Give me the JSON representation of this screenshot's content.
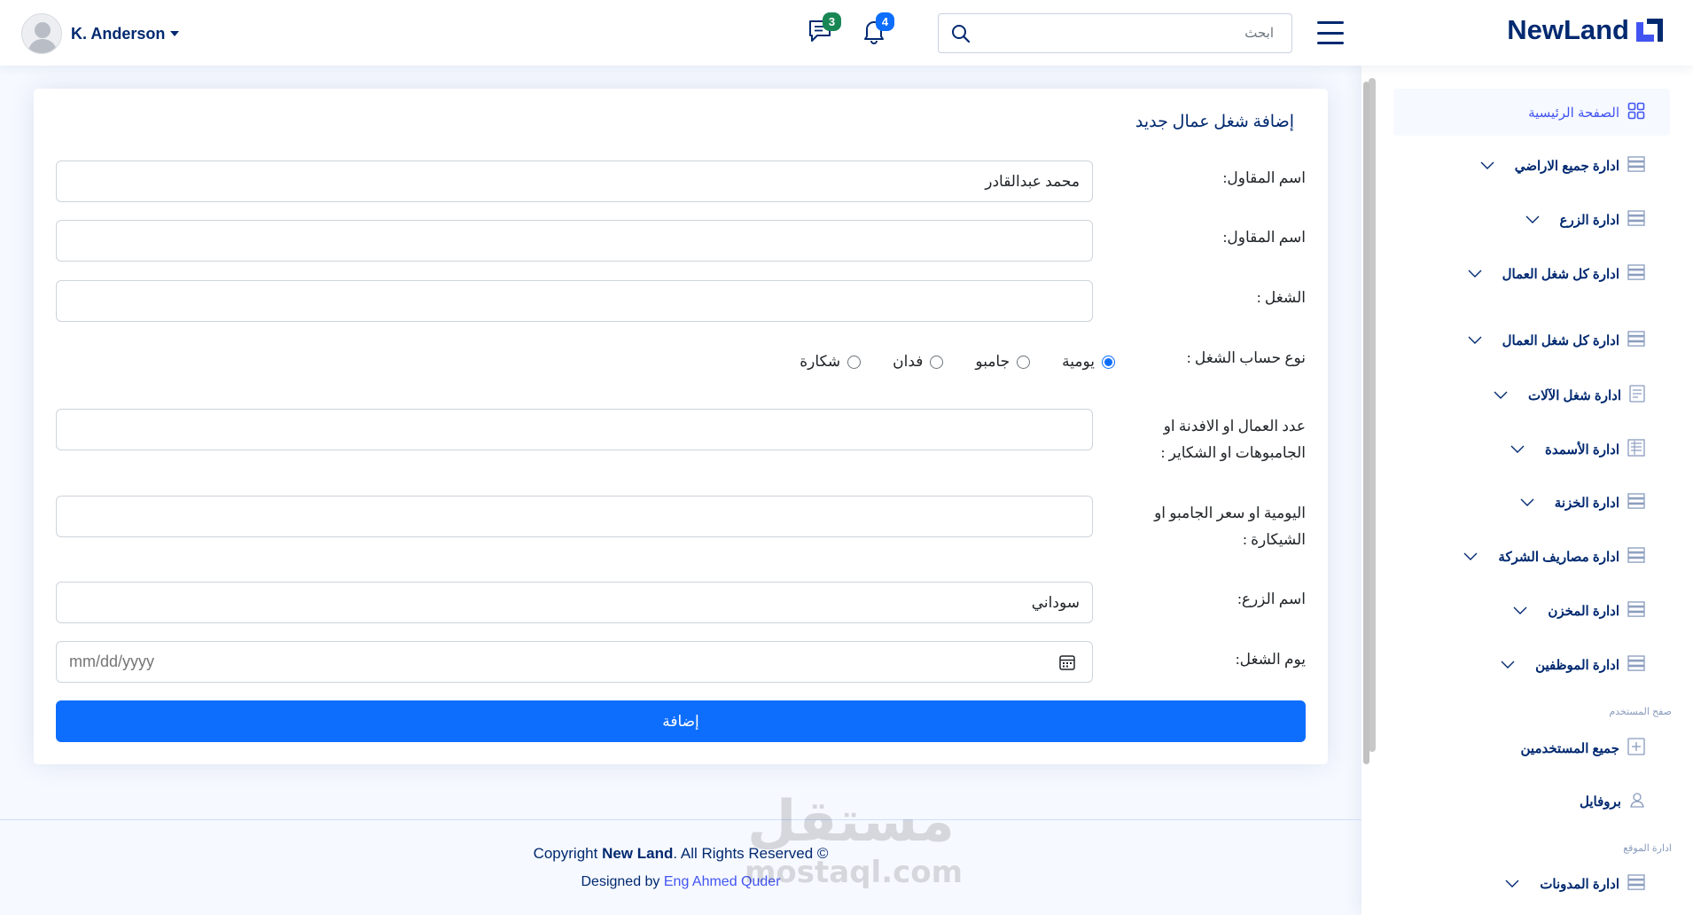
{
  "header": {
    "brand": "NewLand",
    "search_placeholder": "ابحث",
    "messages_count": "3",
    "notifications_count": "4",
    "user_name": "K. Anderson"
  },
  "sidebar": {
    "home": "الصفحة الرئيسية",
    "items": [
      "ادارة جميع الاراضي",
      "ادارة الزرع",
      "ادارة كل شغل العمال",
      "ادارة كل شغل العمال",
      "ادارة شغل الآلات",
      "ادارة الأسمدة",
      "ادارة الخزنة",
      "ادارة مصاريف الشركة",
      "ادارة المخزن",
      "ادارة الموظفين"
    ],
    "users_heading": "صفح المستخدم",
    "users_items": [
      "جميع المستخدمين",
      "بروفايل"
    ],
    "site_heading": "ادارة الموقع",
    "site_items": [
      "ادارة المدونات"
    ]
  },
  "form": {
    "title": "إضافة شغل عمال جديد",
    "contractor_label": "اسم المقاول:",
    "contractor_value": "محمد عبدالقادر",
    "contractor2_label": "اسم المقاول:",
    "contractor2_value": "",
    "work_label": "الشغل :",
    "work_value": "",
    "calc_type_label": "نوع حساب الشغل :",
    "calc_options": [
      "يومية",
      "جامبو",
      "فدان",
      "شكارة"
    ],
    "calc_selected": "يومية",
    "count_label": "عدد العمال او الافدنة او الجامبوهات او الشكاير :",
    "count_value": "",
    "price_label": "اليومية او سعر الجامبو او الشيكارة :",
    "price_value": "",
    "crop_label": "اسم الزرع:",
    "crop_value": "سوداني",
    "date_label": "يوم الشغل:",
    "date_placeholder": "mm/dd/yyyy",
    "submit_label": "إضافة"
  },
  "footer": {
    "copy_prefix": "Copyright ",
    "brand": "New Land",
    "copy_suffix": ". All Rights Reserved ©",
    "designed_prefix": "Designed by ",
    "designer": "Eng Ahmed Quder"
  },
  "watermark": {
    "arabic": "مستقل",
    "latin": "mostaql.com"
  },
  "colors": {
    "primary": "#0d6efd",
    "navy": "#012970",
    "accent": "#4154f1"
  }
}
